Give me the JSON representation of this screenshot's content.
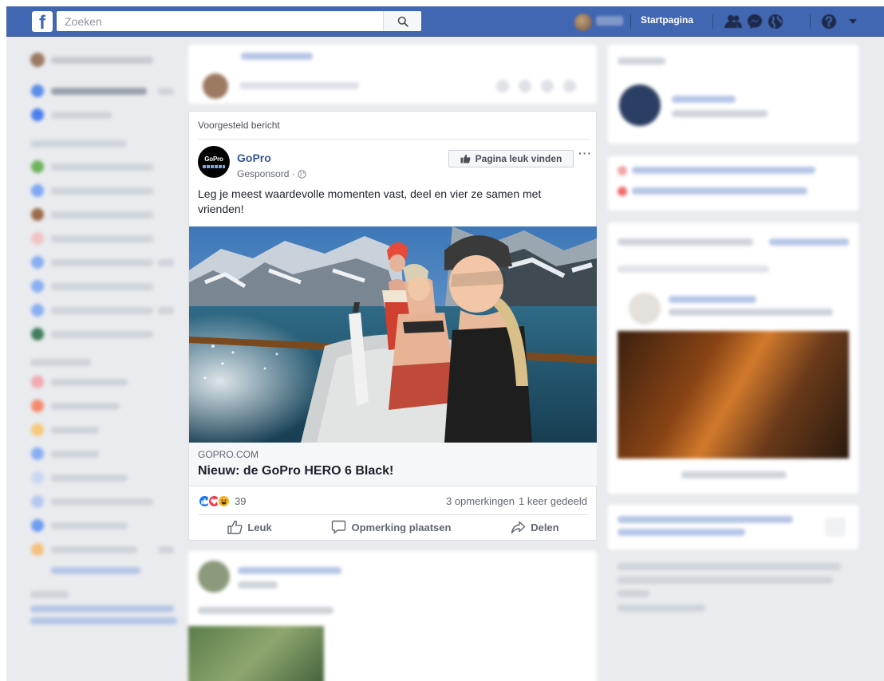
{
  "topbar": {
    "logo": "f",
    "search_placeholder": "Zoeken",
    "home_label": "Startpagina",
    "icons": [
      "friends-icon",
      "messenger-icon",
      "notifications-icon",
      "help-icon",
      "caret-down-icon"
    ]
  },
  "post": {
    "suggested_label": "Voorgesteld bericht",
    "page_name": "GoPro",
    "logo_text": "GoPro",
    "sponsored_label": "Gesponsord ·",
    "like_page_label": "Pagina leuk vinden",
    "more_label": "···",
    "text": "Leg je meest waardevolle momenten vast, deel en vier ze samen met vrienden!",
    "link_domain": "GOPRO.COM",
    "link_title": "Nieuw: de GoPro HERO 6 Black!",
    "reaction_count": "39",
    "comments": "3 opmerkingen",
    "shares": "1 keer gedeeld",
    "actions": {
      "like": "Leuk",
      "comment": "Opmerking plaatsen",
      "share": "Delen"
    }
  },
  "colors": {
    "brand_blue": "#4267b2",
    "link_blue": "#365899",
    "like_blue": "#1877f2",
    "love_red": "#f33e58",
    "haha_yellow": "#f7b125"
  }
}
